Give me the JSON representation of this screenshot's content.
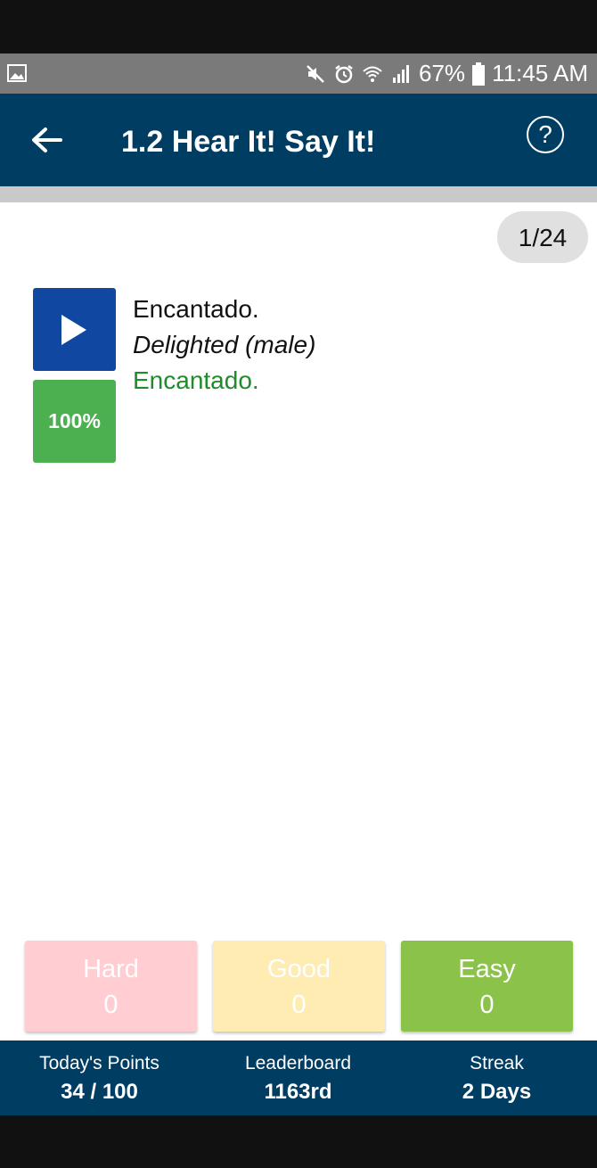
{
  "status_bar": {
    "battery": "67%",
    "time": "11:45 AM"
  },
  "app_bar": {
    "title": "1.2 Hear It! Say It!"
  },
  "content": {
    "counter": "1/24",
    "phrase_spanish": "Encantado.",
    "phrase_english": "Delighted (male)",
    "phrase_response": "Encantado.",
    "score": "100%"
  },
  "ratings": [
    {
      "label": "Hard",
      "count": "0",
      "color": "#ffcdd2"
    },
    {
      "label": "Good",
      "count": "0",
      "color": "#ffecb3"
    },
    {
      "label": "Easy",
      "count": "0",
      "color": "#8bc34a"
    }
  ],
  "footer": {
    "points_label": "Today's Points",
    "points_value": "34 / 100",
    "leaderboard_label": "Leaderboard",
    "leaderboard_value": "1163rd",
    "streak_label": "Streak",
    "streak_value": "2 Days"
  },
  "colors": {
    "appbar": "#003d63",
    "play": "#0f47a1",
    "score": "#4caf50",
    "response_text": "#1e8c2a"
  }
}
